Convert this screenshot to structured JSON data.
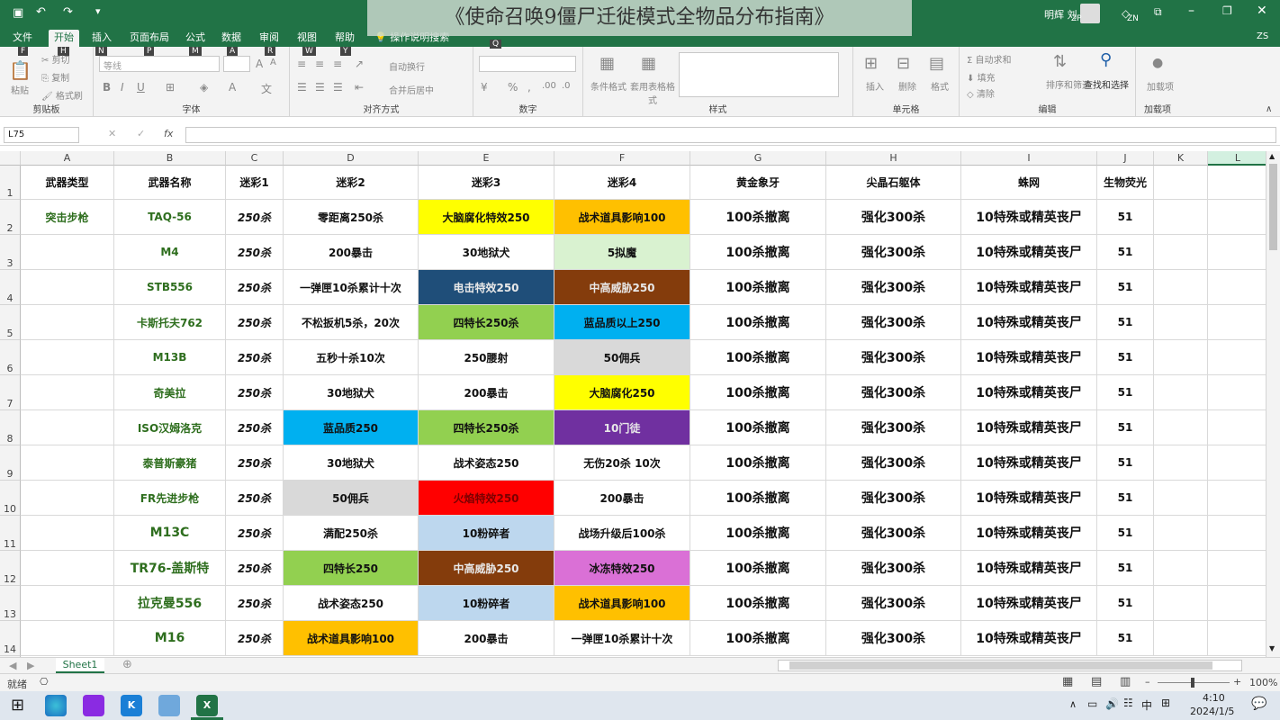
{
  "overlay_title": "《使命召唤9僵尸迁徙模式全物品分布指南》",
  "window": {
    "user": "明辉 刘",
    "zp": "ZP",
    "zn": "ZN",
    "zs": "ZS"
  },
  "tabs": [
    "文件",
    "开始",
    "插入",
    "页面布局",
    "公式",
    "数据",
    "审阅",
    "视图",
    "帮助",
    "操作说明搜索"
  ],
  "keytips": [
    "F",
    "H",
    "N",
    "P",
    "M",
    "A",
    "R",
    "W",
    "Y",
    "Q"
  ],
  "ribbon": {
    "clipboard": {
      "label": "剪贴板",
      "paste": "粘贴",
      "cut": "剪切",
      "copy": "复制",
      "painter": "格式刷"
    },
    "font": {
      "label": "字体",
      "font_name": "等线",
      "bold": "B",
      "italic": "I",
      "underline": "U"
    },
    "align": {
      "label": "对齐方式",
      "wrap": "自动换行",
      "merge": "合并后居中"
    },
    "number": {
      "label": "数字"
    },
    "styles": {
      "label": "样式",
      "cond": "条件格式",
      "table": "套用表格格式"
    },
    "cells": {
      "label": "单元格",
      "insert": "插入",
      "delete": "删除",
      "format": "格式"
    },
    "editing": {
      "label": "编辑",
      "autosum": "自动求和",
      "fill": "填充",
      "clear": "清除",
      "sort": "排序和筛选",
      "find": "查找和选择"
    },
    "addins": {
      "label": "加载项",
      "addin": "加载项"
    }
  },
  "formula_bar": {
    "name_box": "L75",
    "fx": "fx",
    "value": ""
  },
  "columns": [
    "A",
    "B",
    "C",
    "D",
    "E",
    "F",
    "G",
    "H",
    "I",
    "J",
    "K",
    "L"
  ],
  "rows": [
    {
      "n": "1",
      "cells": [
        "武器类型",
        "武器名称",
        "迷彩1",
        "迷彩2",
        "迷彩3",
        "迷彩4",
        "黄金象牙",
        "尖晶石躯体",
        "蛛网",
        "生物荧光",
        "",
        ""
      ]
    },
    {
      "n": "2",
      "cells": [
        "突击步枪",
        "TAQ-56",
        "250杀",
        "零距离250杀",
        "大脑腐化特效250",
        "战术道具影响100",
        "100杀撤离",
        "强化300杀",
        "10特殊或精英丧尸",
        "51",
        "",
        ""
      ]
    },
    {
      "n": "3",
      "cells": [
        "",
        "M4",
        "250杀",
        "200暴击",
        "30地狱犬",
        "5拟魔",
        "100杀撤离",
        "强化300杀",
        "10特殊或精英丧尸",
        "51",
        "",
        ""
      ]
    },
    {
      "n": "4",
      "cells": [
        "",
        "STB556",
        "250杀",
        "一弹匣10杀累计十次",
        "电击特效250",
        "中高威胁250",
        "100杀撤离",
        "强化300杀",
        "10特殊或精英丧尸",
        "51",
        "",
        ""
      ]
    },
    {
      "n": "5",
      "cells": [
        "",
        "卡斯托夫762",
        "250杀",
        "不松扳机5杀，20次",
        "四特长250杀",
        "蓝品质以上250",
        "100杀撤离",
        "强化300杀",
        "10特殊或精英丧尸",
        "51",
        "",
        ""
      ]
    },
    {
      "n": "6",
      "cells": [
        "",
        "M13B",
        "250杀",
        "五秒十杀10次",
        "250腰射",
        "50佣兵",
        "100杀撤离",
        "强化300杀",
        "10特殊或精英丧尸",
        "51",
        "",
        ""
      ]
    },
    {
      "n": "7",
      "cells": [
        "",
        "奇美拉",
        "250杀",
        "30地狱犬",
        "200暴击",
        "大脑腐化250",
        "100杀撤离",
        "强化300杀",
        "10特殊或精英丧尸",
        "51",
        "",
        ""
      ]
    },
    {
      "n": "8",
      "cells": [
        "",
        "ISO汉姆洛克",
        "250杀",
        "蓝品质250",
        "四特长250杀",
        "10门徒",
        "100杀撤离",
        "强化300杀",
        "10特殊或精英丧尸",
        "51",
        "",
        ""
      ]
    },
    {
      "n": "9",
      "cells": [
        "",
        "泰普斯豪猪",
        "250杀",
        "30地狱犬",
        "战术姿态250",
        "无伤20杀 10次",
        "100杀撤离",
        "强化300杀",
        "10特殊或精英丧尸",
        "51",
        "",
        ""
      ]
    },
    {
      "n": "10",
      "cells": [
        "",
        "FR先进步枪",
        "250杀",
        "50佣兵",
        "火焰特效250",
        "200暴击",
        "100杀撤离",
        "强化300杀",
        "10特殊或精英丧尸",
        "51",
        "",
        ""
      ]
    },
    {
      "n": "11",
      "cells": [
        "",
        "M13C",
        "250杀",
        "满配250杀",
        "10粉碎者",
        "战场升级后100杀",
        "100杀撤离",
        "强化300杀",
        "10特殊或精英丧尸",
        "51",
        "",
        ""
      ]
    },
    {
      "n": "12",
      "cells": [
        "",
        "TR76-盖斯特",
        "250杀",
        "四特长250",
        "中高威胁250",
        "冰冻特效250",
        "100杀撤离",
        "强化300杀",
        "10特殊或精英丧尸",
        "51",
        "",
        ""
      ]
    },
    {
      "n": "13",
      "cells": [
        "",
        "拉克曼556",
        "250杀",
        "战术姿态250",
        "10粉碎者",
        "战术道具影响100",
        "100杀撤离",
        "强化300杀",
        "10特殊或精英丧尸",
        "51",
        "",
        ""
      ]
    },
    {
      "n": "14",
      "cells": [
        "",
        "M16",
        "250杀",
        "战术道具影响100",
        "200暴击",
        "一弹匣10杀累计十次",
        "100杀撤离",
        "强化300杀",
        "10特殊或精英丧尸",
        "51",
        "",
        ""
      ]
    }
  ],
  "fills": {
    "2": {
      "4": "#ffff00",
      "5": "#ffc000"
    },
    "3": {
      "5": "#d9f2d0"
    },
    "4": {
      "4": "#1f4e79",
      "5": "#843c0c"
    },
    "5": {
      "4": "#92d050",
      "5": "#00b0f0"
    },
    "6": {
      "5": "#d9d9d9"
    },
    "7": {
      "5": "#ffff00"
    },
    "8": {
      "3": "#00b0f0",
      "4": "#92d050",
      "5": "#7030a0"
    },
    "10": {
      "3": "#d9d9d9",
      "4": "#ff0000"
    },
    "11": {
      "4": "#bdd7ee"
    },
    "12": {
      "3": "#92d050",
      "4": "#843c0c",
      "5": "#da70d6"
    },
    "13": {
      "4": "#bdd7ee",
      "5": "#ffc000"
    },
    "14": {
      "3": "#ffc000"
    }
  },
  "sheet_tab": "Sheet1",
  "status": {
    "ready": "就绪",
    "zoom": "100%"
  },
  "taskbar": {
    "time": "4:10",
    "date": "2024/1/5",
    "ime": "中"
  }
}
